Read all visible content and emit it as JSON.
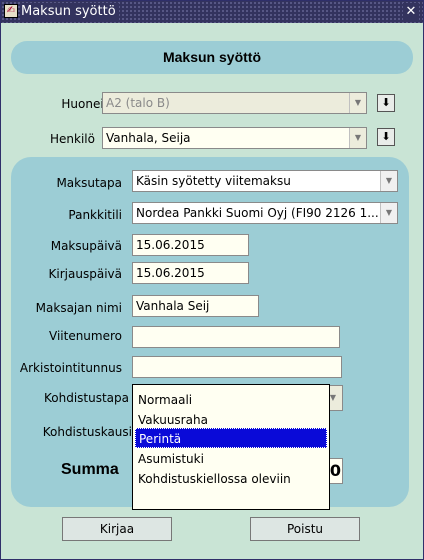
{
  "window": {
    "title": "Maksun syöttö",
    "close_glyph": "✕",
    "app_icon": "✍"
  },
  "header": {
    "title": "Maksun syöttö"
  },
  "top_fields": {
    "huoneisto": {
      "label": "Huoneisto",
      "value": "A2 (talo B)"
    },
    "henkilo": {
      "label": "Henkilö",
      "value": "Vanhala, Seija"
    }
  },
  "form": {
    "maksutapa": {
      "label": "Maksutapa",
      "value": "Käsin syötetty viitemaksu"
    },
    "pankkitili": {
      "label": "Pankkitili",
      "value": "Nordea Pankki Suomi Oyj (FI90 2126 1..."
    },
    "maksupaiva": {
      "label": "Maksupäivä",
      "value": "15.06.2015"
    },
    "kirjauspaiva": {
      "label": "Kirjauspäivä",
      "value": "15.06.2015"
    },
    "maksajan_nimi": {
      "label": "Maksajan nimi",
      "value": "Vanhala Seij"
    },
    "viitenumero": {
      "label": "Viitenumero",
      "value": ""
    },
    "arkistointitunnus": {
      "label": "Arkistointitunnus",
      "value": ""
    },
    "kohdistustapa": {
      "label": "Kohdistustapa"
    },
    "kohdistuskausi": {
      "label": "Kohdistuskausi"
    },
    "summa": {
      "label": "Summa",
      "value": "0"
    }
  },
  "dropdown": {
    "options": [
      "Normaali",
      "Vakuusraha",
      "Perintä",
      "Asumistuki",
      "Kohdistuskiellossa oleviin"
    ],
    "selected": "Perintä"
  },
  "buttons": {
    "kirjaa": "Kirjaa",
    "poistu": "Poistu"
  },
  "icons": {
    "dropdown_arrow": "▼",
    "download": "⬇"
  }
}
